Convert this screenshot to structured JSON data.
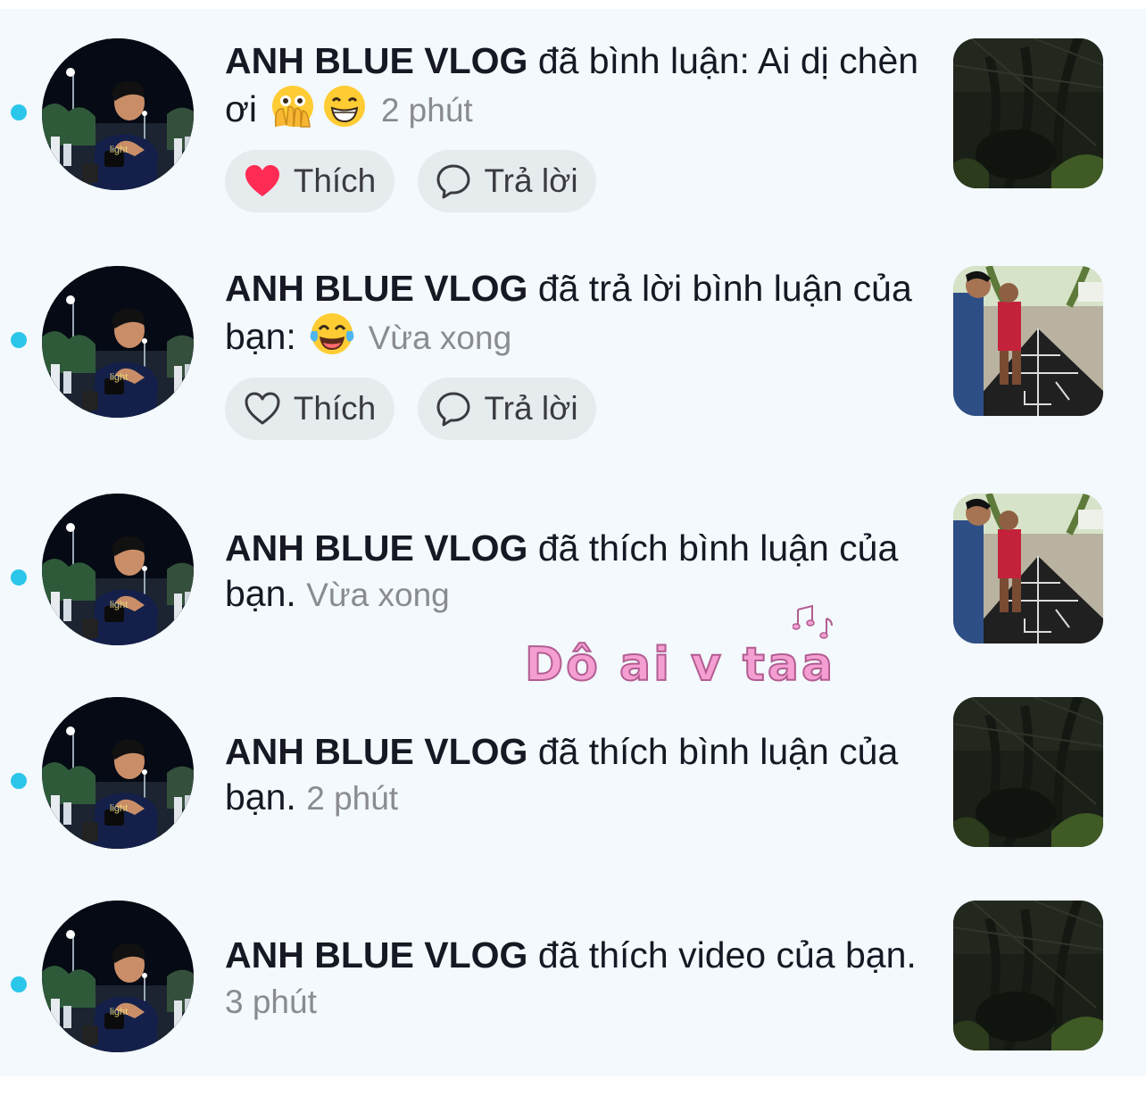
{
  "notifications": [
    {
      "username": "ANH BLUE VLOG",
      "message": "đã bình luận: Ai dị chèn ơi",
      "emojis": [
        "face-with-open-eyes-and-hand-over-mouth",
        "grinning-face-with-smiling-eyes"
      ],
      "time": "2 phút",
      "like_label": "Thích",
      "reply_label": "Trả lời",
      "liked": true,
      "thumbnail": "dark-forest-video"
    },
    {
      "username": "ANH BLUE VLOG",
      "message": "đã trả lời bình luận của bạn:",
      "emojis": [
        "face-with-tears-of-joy"
      ],
      "time": "Vừa xong",
      "like_label": "Thích",
      "reply_label": "Trả lời",
      "liked": false,
      "thumbnail": "boys-with-kite-video"
    },
    {
      "username": "ANH BLUE VLOG",
      "message": "đã thích bình luận của bạn.",
      "time": "Vừa xong",
      "thumbnail": "boys-with-kite-video"
    },
    {
      "username": "ANH BLUE VLOG",
      "message": "đã thích bình luận của bạn.",
      "time": "2 phút",
      "thumbnail": "dark-forest-video"
    },
    {
      "username": "ANH BLUE VLOG",
      "message": "đã thích video của bạn.",
      "time": "3 phút",
      "thumbnail": "dark-forest-video"
    }
  ],
  "overlay_text": "Dô ai v taa",
  "colors": {
    "unread_dot": "#2bc6ea",
    "like_heart": "#fe2c55",
    "overlay_pink": "#f49ed2",
    "background": "#f3f9fc"
  }
}
